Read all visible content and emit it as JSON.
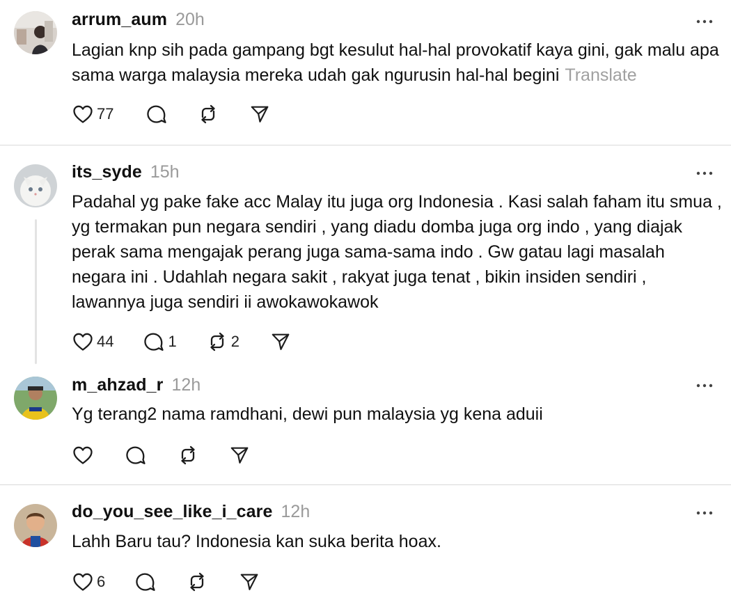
{
  "posts": [
    {
      "username": "arrum_aum",
      "time": "20h",
      "text": "Lagian knp sih pada gampang bgt kesulut hal-hal provokatif kaya gini, gak malu apa sama warga malaysia mereka udah gak ngurusin hal-hal begini",
      "translate": "Translate",
      "likes": "77"
    },
    {
      "username": "its_syde",
      "time": "15h",
      "text": "Padahal yg pake fake acc Malay itu juga org Indonesia . Kasi salah faham itu smua , yg termakan pun negara sendiri , yang diadu domba juga org indo , yang diajak perak sama mengajak perang juga sama-sama indo . Gw gatau lagi masalah negara ini . Udahlah negara sakit , rakyat juga tenat , bikin insiden sendiri , lawannya juga sendiri ii awokawokawok",
      "likes": "44",
      "replies": "1",
      "reposts": "2"
    },
    {
      "username": "m_ahzad_r",
      "time": "12h",
      "text": "Yg terang2 nama ramdhani, dewi pun malaysia yg kena aduii"
    },
    {
      "username": "do_you_see_like_i_care",
      "time": "12h",
      "text": "Lahh Baru tau? Indonesia kan suka berita hoax.",
      "likes": "6"
    }
  ],
  "icons": {
    "like": "heart-icon",
    "reply": "comment-icon",
    "repost": "repost-icon",
    "share": "send-icon",
    "more": "more-icon"
  }
}
